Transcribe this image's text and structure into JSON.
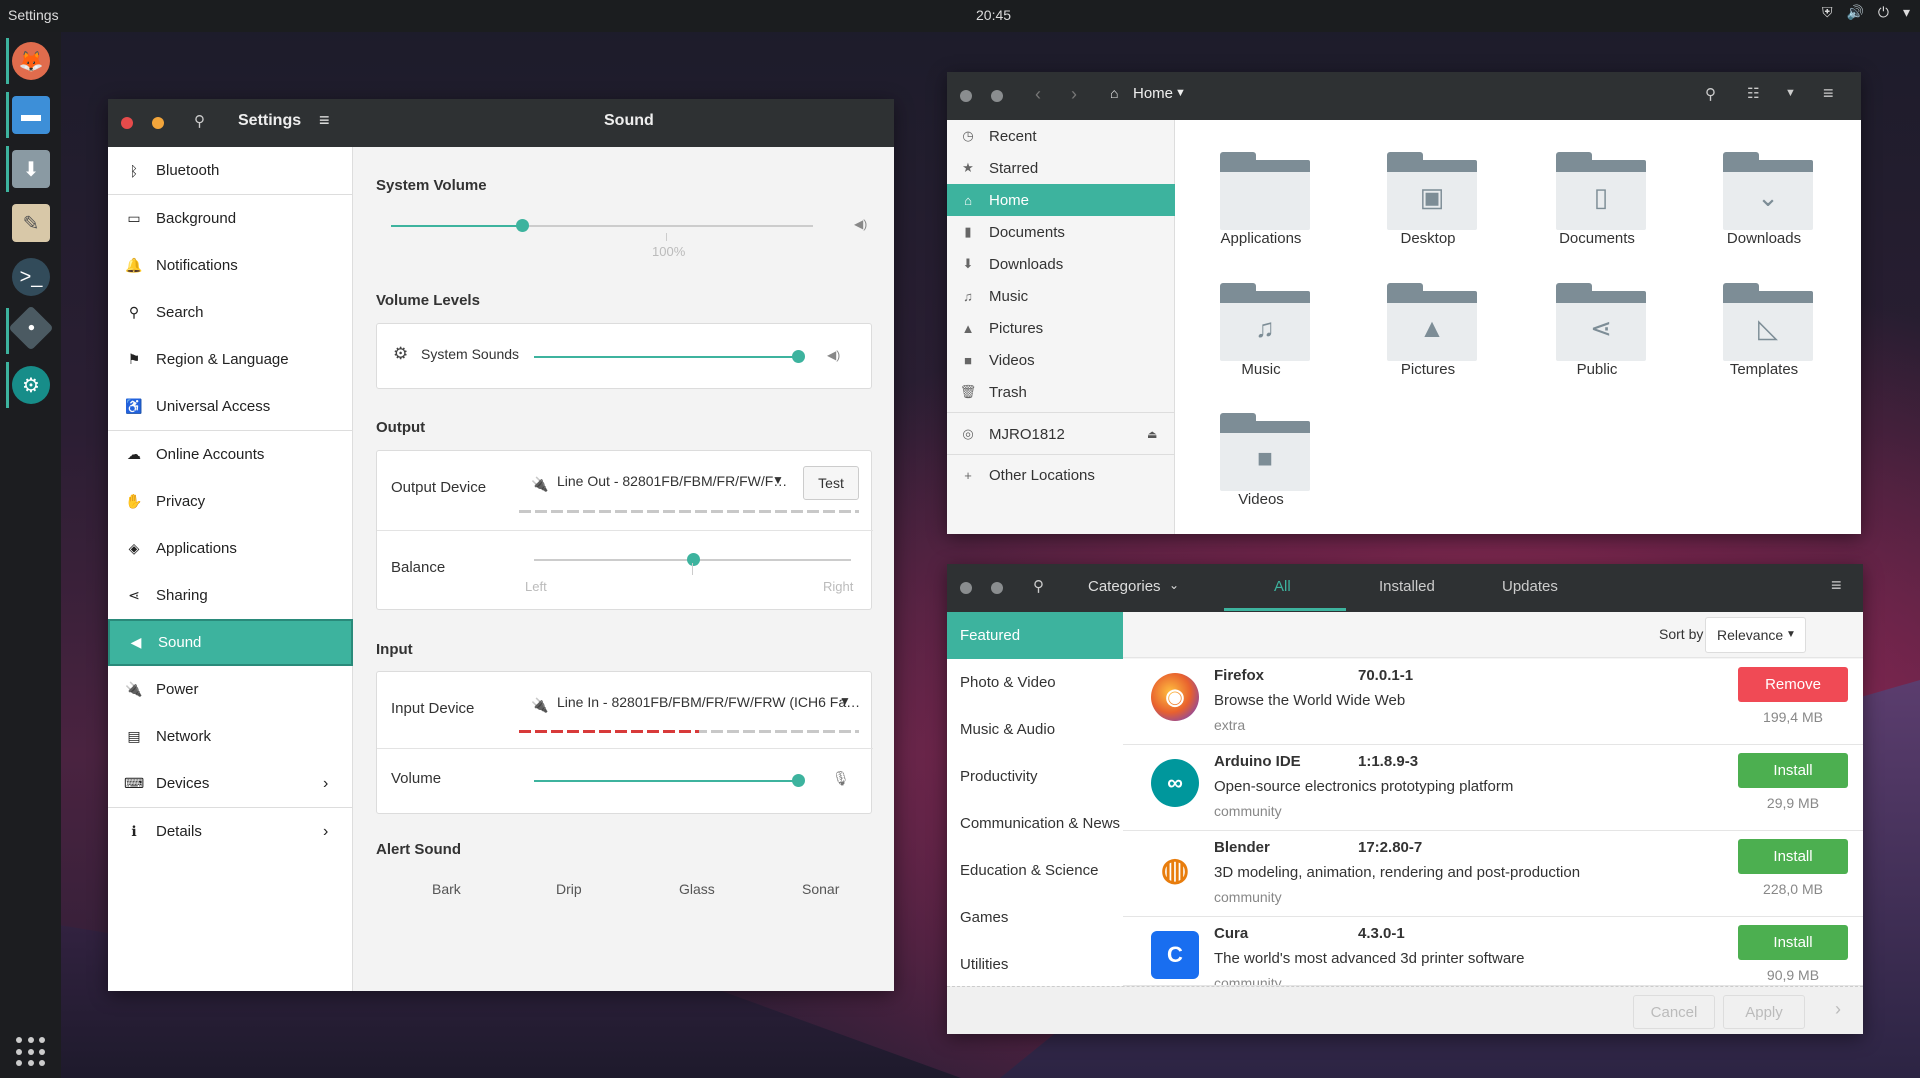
{
  "topbar": {
    "title": "Settings",
    "clock": "20:45"
  },
  "dock": [
    "fox-app",
    "folder",
    "downloads",
    "text-editor",
    "terminal",
    "app",
    "gitkraken"
  ],
  "settings": {
    "sidebar_title": "Settings",
    "page_title": "Sound",
    "sidebar": [
      "Bluetooth",
      "Background",
      "Notifications",
      "Search",
      "Region & Language",
      "Universal Access",
      "Online Accounts",
      "Privacy",
      "Applications",
      "Sharing",
      "Sound",
      "Power",
      "Network",
      "Devices",
      "Details"
    ],
    "system_volume": {
      "heading": "System Volume",
      "value_label": "100%",
      "level": 0.31
    },
    "volume_levels": {
      "heading": "Volume Levels",
      "system_sounds": "System Sounds",
      "level": 1.0
    },
    "output": {
      "heading": "Output",
      "device_label": "Output Device",
      "device_value": "Line Out - 82801FB/FBM/FR/FW/F…",
      "test": "Test",
      "balance_label": "Balance",
      "left": "Left",
      "right": "Right",
      "balance": 0.5
    },
    "input": {
      "heading": "Input",
      "device_label": "Input Device",
      "device_value": "Line In - 82801FB/FBM/FR/FW/FRW (ICH6 Fa…",
      "volume_label": "Volume",
      "volume": 1.0,
      "input_level": 0.53
    },
    "alert": {
      "heading": "Alert Sound",
      "options": [
        "Bark",
        "Drip",
        "Glass",
        "Sonar"
      ]
    }
  },
  "files": {
    "location": "Home",
    "sidebar": [
      "Recent",
      "Starred",
      "Home",
      "Documents",
      "Downloads",
      "Music",
      "Pictures",
      "Videos",
      "Trash"
    ],
    "device": "MJRO1812",
    "other": "Other Locations",
    "folders": [
      "Applications",
      "Desktop",
      "Documents",
      "Downloads",
      "Music",
      "Pictures",
      "Public",
      "Templates",
      "Videos"
    ]
  },
  "software": {
    "categories_label": "Categories",
    "tabs": [
      "All",
      "Installed",
      "Updates"
    ],
    "categories": [
      "Featured",
      "Photo & Video",
      "Music & Audio",
      "Productivity",
      "Communication & News",
      "Education & Science",
      "Games",
      "Utilities"
    ],
    "sort_by": "Sort by",
    "sort_value": "Relevance",
    "apps": [
      {
        "name": "Firefox",
        "version": "70.0.1-1",
        "desc": "Browse the World Wide Web",
        "source": "extra",
        "action": "Remove",
        "size": "199,4 MB"
      },
      {
        "name": "Arduino IDE",
        "version": "1:1.8.9-3",
        "desc": "Open-source electronics prototyping platform",
        "source": "community",
        "action": "Install",
        "size": "29,9 MB"
      },
      {
        "name": "Blender",
        "version": "17:2.80-7",
        "desc": "3D modeling, animation, rendering and post-production",
        "source": "community",
        "action": "Install",
        "size": "228,0 MB"
      },
      {
        "name": "Cura",
        "version": "4.3.0-1",
        "desc": "The world's most advanced 3d printer software",
        "source": "community",
        "action": "Install",
        "size": "90,9 MB"
      }
    ],
    "cancel": "Cancel",
    "apply": "Apply"
  }
}
